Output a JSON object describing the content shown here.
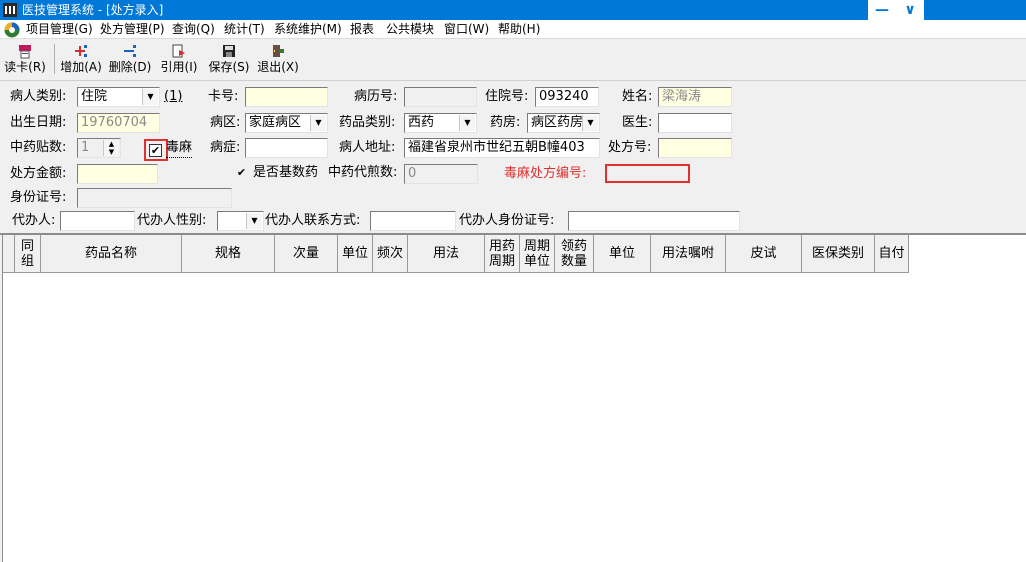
{
  "window": {
    "title": "医技管理系统 - [处方录入]"
  },
  "menu": {
    "items": [
      "项目管理(G)",
      "处方管理(P)",
      "查询(Q)",
      "统计(T)",
      "系统维护(M)",
      "报表",
      "公共模块",
      "窗口(W)",
      "帮助(H)"
    ]
  },
  "toolbar": {
    "read_card": "读卡(R)",
    "add": "增加(A)",
    "delete": "删除(D)",
    "cite": "引用(I)",
    "save": "保存(S)",
    "exit": "退出(X)"
  },
  "form": {
    "patient_type_label": "病人类别:",
    "patient_type_value": "住院",
    "patient_type_code": "(1)",
    "card_no_label": "卡号:",
    "card_no_value": "",
    "record_no_label": "病历号:",
    "record_no_value": "",
    "inpatient_no_label": "住院号:",
    "inpatient_no_value": "093240",
    "name_label": "姓名:",
    "name_value": "梁海涛",
    "birth_label": "出生日期:",
    "birth_value": "19760704",
    "ward_label": "病区:",
    "ward_value": "家庭病区",
    "drug_type_label": "药品类别:",
    "drug_type_value": "西药",
    "pharmacy_label": "药房:",
    "pharmacy_value": "病区药房",
    "doctor_label": "医生:",
    "doctor_value": "",
    "herb_doses_label": "中药贴数:",
    "herb_doses_value": "1",
    "narcotic_label": "毒麻",
    "diagnosis_label": "病症:",
    "diagnosis_value": "",
    "address_label": "病人地址:",
    "address_value": "福建省泉州市世纪五朝B幢403",
    "rx_no_label": "处方号:",
    "rx_no_value": "",
    "rx_amount_label": "处方金额:",
    "rx_amount_value": "",
    "basic_drug_label": "是否基数药",
    "decoct_label": "中药代煎数:",
    "decoct_value": "0",
    "narcotic_rx_label": "毒麻处方编号:",
    "narcotic_rx_value": "",
    "id_no_label": "身份证号:",
    "id_no_value": "",
    "agent_label": "代办人:",
    "agent_value": "",
    "agent_gender_label": "代办人性别:",
    "agent_gender_value": "",
    "agent_contact_label": "代办人联系方式:",
    "agent_contact_value": "",
    "agent_id_label": "代办人身份证号:",
    "agent_id_value": ""
  },
  "grid": {
    "columns": [
      "同组",
      "药品名称",
      "规格",
      "次量",
      "单位",
      "频次",
      "用法",
      "用药周期",
      "周期单位",
      "领药数量",
      "单位",
      "用法嘱咐",
      "皮试",
      "医保类别",
      "自付"
    ]
  },
  "colors": {
    "titlebar": "#0078d7",
    "highlight_red": "#e03030",
    "field_yellow": "#ffffe1"
  }
}
